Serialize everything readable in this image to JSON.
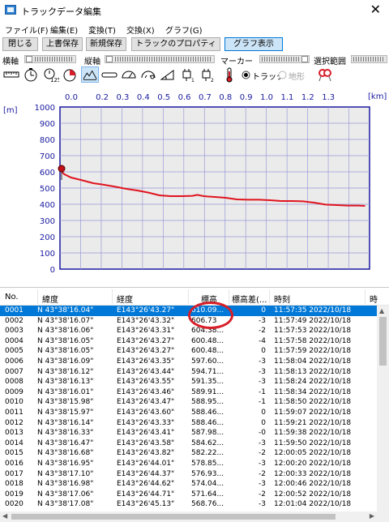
{
  "window": {
    "title": "トラックデータ編集",
    "close": "✕"
  },
  "menu": [
    "ファイル(F)",
    "編集(E)",
    "変換(T)",
    "交換(X)",
    "グラフ(G)"
  ],
  "toolbar": {
    "close_label": "閉じる",
    "overwrite_label": "上書保存",
    "save_new_label": "新規保存",
    "properties_label": "トラックのプロパティ",
    "graph_label": "グラフ表示"
  },
  "groups": {
    "horizontal": "横軸",
    "vertical": "縦軸",
    "marker": "マーカー",
    "range": "選択範囲"
  },
  "radio": {
    "track": "トラック",
    "terrain": "地形",
    "selected": "track"
  },
  "icons": [
    "ruler-icon",
    "clock-icon",
    "stopwatch-125-icon",
    "pie-clock-icon",
    "elevation-profile-icon",
    "speed-bar-icon",
    "speedometer-icon",
    "gauge-icon",
    "slope-icon",
    "plug-1-icon",
    "plug-2-icon",
    "thermometer-icon",
    "map-marker-icon"
  ],
  "chart_data": {
    "type": "line",
    "x_unit": "[km]",
    "y_unit": "[m]",
    "x_ticks": [
      "0.0",
      "0.2",
      "0.3",
      "0.4",
      "0.5",
      "0.6",
      "0.7",
      "0.8",
      "0.9",
      "1.0",
      "1.1",
      "1.2",
      "1.3"
    ],
    "y_ticks": [
      "1000",
      "900",
      "800",
      "700",
      "600",
      "500",
      "400",
      "300",
      "200",
      "100",
      "0"
    ],
    "xlim": [
      0,
      1.4
    ],
    "ylim": [
      0,
      1000
    ],
    "grid": true,
    "line_color": "#e0141e",
    "x": [
      0.0,
      0.02,
      0.05,
      0.1,
      0.15,
      0.2,
      0.25,
      0.3,
      0.35,
      0.4,
      0.45,
      0.5,
      0.55,
      0.6,
      0.62,
      0.65,
      0.7,
      0.75,
      0.8,
      0.85,
      0.9,
      0.95,
      1.0,
      1.05,
      1.1,
      1.15,
      1.2,
      1.25,
      1.3,
      1.35,
      1.38
    ],
    "y": [
      610,
      585,
      565,
      548,
      530,
      520,
      508,
      495,
      485,
      472,
      455,
      450,
      450,
      452,
      458,
      450,
      445,
      440,
      430,
      428,
      428,
      425,
      420,
      420,
      418,
      410,
      398,
      395,
      392,
      392,
      390
    ]
  },
  "table": {
    "columns": [
      "No.",
      "緯度",
      "経度",
      "標高",
      "標高差(...",
      "時刻",
      "時"
    ],
    "rows": [
      [
        "0001",
        "N 43°38'16.04\"",
        "E143°26'43.27\"",
        "610.09...",
        "0",
        "11:57:35 2022/10/18"
      ],
      [
        "0002",
        "N 43°38'16.07\"",
        "E143°26'43.32\"",
        "606.73",
        "-3",
        "11:57:49 2022/10/18"
      ],
      [
        "0003",
        "N 43°38'16.06\"",
        "E143°26'43.31\"",
        "604.38...",
        "-2",
        "11:57:53 2022/10/18"
      ],
      [
        "0004",
        "N 43°38'16.05\"",
        "E143°26'43.27\"",
        "600.48...",
        "-4",
        "11:57:58 2022/10/18"
      ],
      [
        "0005",
        "N 43°38'16.05\"",
        "E143°26'43.27\"",
        "600.48...",
        "0",
        "11:57:59 2022/10/18"
      ],
      [
        "0006",
        "N 43°38'16.09\"",
        "E143°26'43.35\"",
        "597.60...",
        "-3",
        "11:58:04 2022/10/18"
      ],
      [
        "0007",
        "N 43°38'16.12\"",
        "E143°26'43.44\"",
        "594.71...",
        "-3",
        "11:58:13 2022/10/18"
      ],
      [
        "0008",
        "N 43°38'16.13\"",
        "E143°26'43.55\"",
        "591.35...",
        "-3",
        "11:58:24 2022/10/18"
      ],
      [
        "0009",
        "N 43°38'16.01\"",
        "E143°26'43.46\"",
        "589.91...",
        "-1",
        "11:58:34 2022/10/18"
      ],
      [
        "0010",
        "N 43°38'15.98\"",
        "E143°26'43.47\"",
        "588.95...",
        "-1",
        "11:58:50 2022/10/18"
      ],
      [
        "0011",
        "N 43°38'15.97\"",
        "E143°26'43.60\"",
        "588.46...",
        "0",
        "11:59:07 2022/10/18"
      ],
      [
        "0012",
        "N 43°38'16.14\"",
        "E143°26'43.33\"",
        "588.46...",
        "0",
        "11:59:21 2022/10/18"
      ],
      [
        "0013",
        "N 43°38'16.33\"",
        "E143°26'43.41\"",
        "587.98...",
        "-0",
        "11:59:38 2022/10/18"
      ],
      [
        "0014",
        "N 43°38'16.47\"",
        "E143°26'43.58\"",
        "584.62...",
        "-3",
        "11:59:50 2022/10/18"
      ],
      [
        "0015",
        "N 43°38'16.68\"",
        "E143°26'43.82\"",
        "582.22...",
        "-2",
        "12:00:05 2022/10/18"
      ],
      [
        "0016",
        "N 43°38'16.95\"",
        "E143°26'44.01\"",
        "578.85...",
        "-3",
        "12:00:20 2022/10/18"
      ],
      [
        "0017",
        "N 43°38'17.10\"",
        "E143°26'44.37\"",
        "576.93...",
        "-2",
        "12:00:33 2022/10/18"
      ],
      [
        "0018",
        "N 43°38'16.98\"",
        "E143°26'44.62\"",
        "574.04...",
        "-3",
        "12:00:46 2022/10/18"
      ],
      [
        "0019",
        "N 43°38'17.06\"",
        "E143°26'44.71\"",
        "571.64...",
        "-2",
        "12:00:52 2022/10/18"
      ],
      [
        "0020",
        "N 43°38'17.08\"",
        "E143°26'45.13\"",
        "568.76...",
        "-3",
        "12:01:04 2022/10/18"
      ]
    ],
    "selected_row": 0
  },
  "colors": {
    "selection": "#0078d7",
    "chart_frame": "#1a1aa0",
    "grid_fill": "#ebebeb",
    "highlight_ellipse": "#d81e28"
  }
}
